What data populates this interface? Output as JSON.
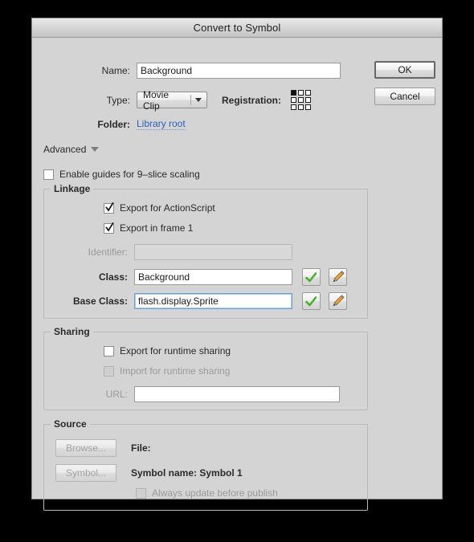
{
  "window": {
    "title": "Convert to Symbol"
  },
  "buttons": {
    "ok": "OK",
    "cancel": "Cancel"
  },
  "fields": {
    "name_label": "Name:",
    "name_value": "Background",
    "type_label": "Type:",
    "type_value": "Movie Clip",
    "registration_label": "Registration:",
    "registration_point": "top-left",
    "folder_label": "Folder:",
    "folder_value": "Library root"
  },
  "advanced": {
    "label": "Advanced",
    "disclosure": "triangle-down",
    "nine_slice_label": "Enable guides for 9–slice scaling",
    "nine_slice_checked": false
  },
  "linkage": {
    "legend": "Linkage",
    "export_actionscript_label": "Export for ActionScript",
    "export_actionscript_checked": true,
    "export_frame1_label": "Export in frame 1",
    "export_frame1_checked": true,
    "identifier_label": "Identifier:",
    "identifier_value": "",
    "identifier_disabled": true,
    "class_label": "Class:",
    "class_value": "Background",
    "base_class_label": "Base Class:",
    "base_class_value": "flash.display.Sprite",
    "base_class_focused": true,
    "validate_icon": "green-check-icon",
    "edit_icon": "pencil-icon"
  },
  "sharing": {
    "legend": "Sharing",
    "export_runtime_label": "Export for runtime sharing",
    "export_runtime_checked": false,
    "import_runtime_label": "Import for runtime sharing",
    "import_runtime_checked": false,
    "import_runtime_disabled": true,
    "url_label": "URL:",
    "url_value": ""
  },
  "source": {
    "legend": "Source",
    "browse_button": "Browse...",
    "browse_disabled": true,
    "file_label": "File:",
    "file_value": "",
    "symbol_button": "Symbol...",
    "symbol_disabled": true,
    "symbol_name_label": "Symbol name: Symbol 1",
    "always_update_label": "Always update before publish",
    "always_update_checked": false,
    "always_update_disabled": true
  },
  "colors": {
    "dialog_background": "#d4d4d4",
    "desktop": "#000000",
    "link": "#2a63b8",
    "focus_border": "#6f9fd0",
    "check_green": "#4caf2e",
    "disabled_text": "#9a9a9a"
  }
}
